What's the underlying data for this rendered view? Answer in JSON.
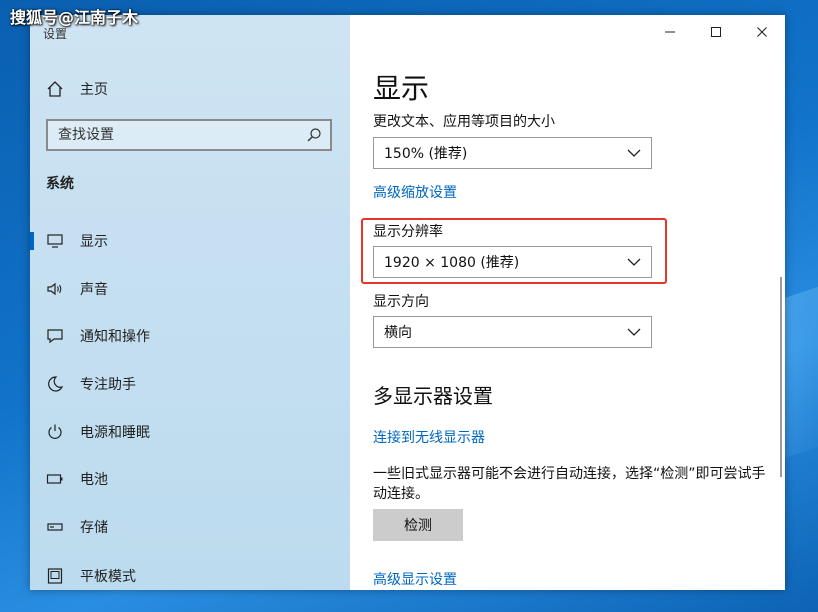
{
  "watermark": "搜狐号@江南子木",
  "sidebar": {
    "app_title": "设置",
    "home_label": "主页",
    "search_placeholder": "查找设置",
    "section": "系统",
    "items": [
      {
        "label": "显示",
        "icon": "monitor-icon",
        "active": true
      },
      {
        "label": "声音",
        "icon": "speaker-icon",
        "active": false
      },
      {
        "label": "通知和操作",
        "icon": "notification-icon",
        "active": false
      },
      {
        "label": "专注助手",
        "icon": "moon-icon",
        "active": false
      },
      {
        "label": "电源和睡眠",
        "icon": "power-icon",
        "active": false
      },
      {
        "label": "电池",
        "icon": "battery-icon",
        "active": false
      },
      {
        "label": "存储",
        "icon": "storage-icon",
        "active": false
      },
      {
        "label": "平板模式",
        "icon": "tablet-icon",
        "active": false
      }
    ]
  },
  "main": {
    "title": "显示",
    "scale": {
      "label": "更改文本、应用等项目的大小",
      "value": "150% (推荐)"
    },
    "advanced_scaling_link": "高级缩放设置",
    "resolution": {
      "label": "显示分辨率",
      "value": "1920 × 1080 (推荐)"
    },
    "orientation": {
      "label": "显示方向",
      "value": "横向"
    },
    "multi_display": {
      "title": "多显示器设置",
      "wireless_link": "连接到无线显示器",
      "description": "一些旧式显示器可能不会进行自动连接，选择“检测”即可尝试手动连接。",
      "detect_button": "检测",
      "advanced_display_link": "高级显示设置"
    }
  },
  "colors": {
    "accent": "#0067c0",
    "highlight": "#e8342c",
    "sidebar_bg": "#c6e0f1"
  }
}
